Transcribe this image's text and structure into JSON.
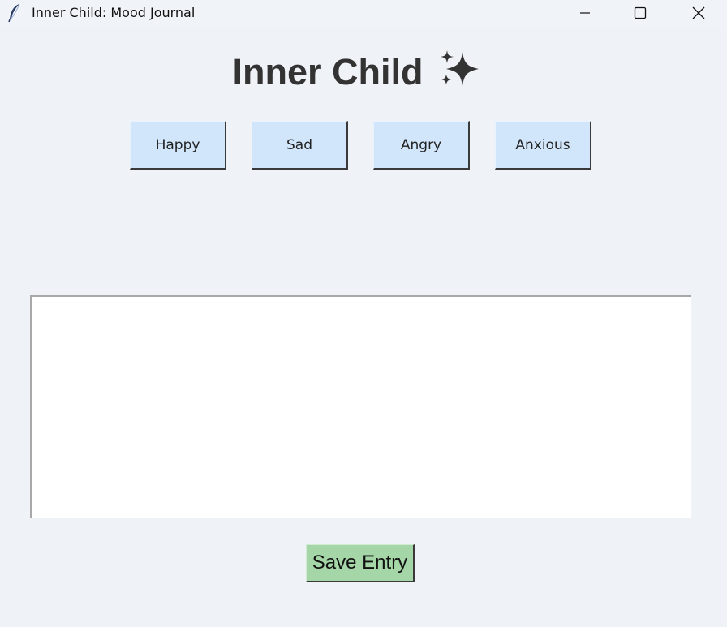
{
  "window": {
    "title": "Inner Child: Mood Journal",
    "app_icon": "feather-icon",
    "controls": [
      "minimize-icon",
      "maximize-icon",
      "close-icon"
    ]
  },
  "header": {
    "title": "Inner Child",
    "emoji_icon": "sparkles-icon"
  },
  "moods": {
    "happy": "Happy",
    "sad": "Sad",
    "angry": "Angry",
    "anxious": "Anxious"
  },
  "journal": {
    "value": ""
  },
  "actions": {
    "save_label": "Save Entry"
  },
  "colors": {
    "background": "#eff2f7",
    "mood_button": "#d1e6fb",
    "save_button": "#a5d6a7",
    "heading_text": "#333333"
  }
}
